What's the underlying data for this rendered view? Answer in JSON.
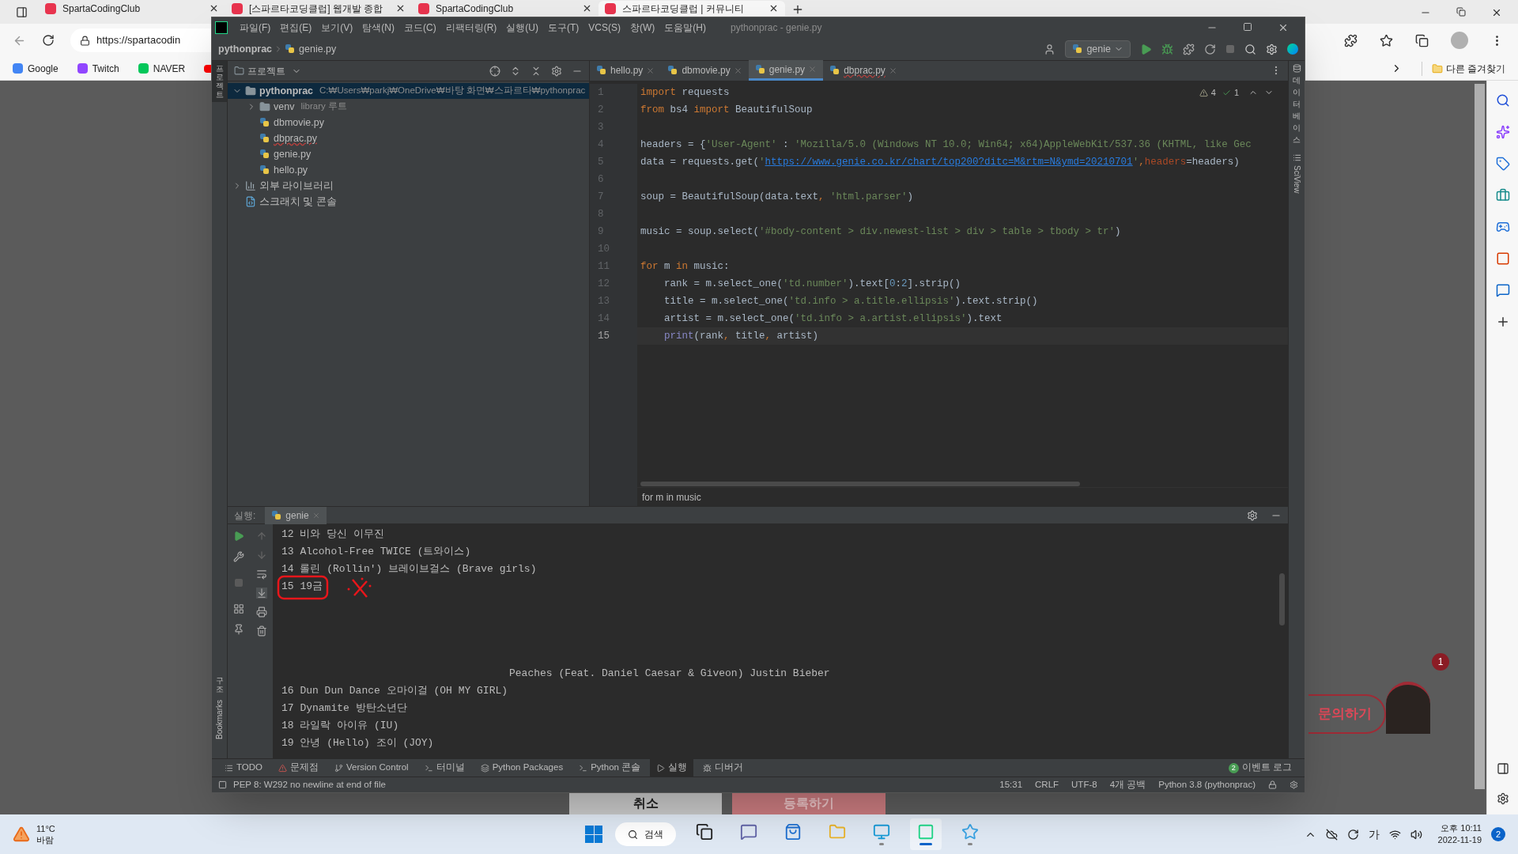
{
  "browser": {
    "tabs": [
      {
        "title": "SpartaCodingClub",
        "selected": false
      },
      {
        "title": "[스파르타코딩클럽] 웹개발 종합",
        "selected": false
      },
      {
        "title": "SpartaCodingClub",
        "selected": false
      },
      {
        "title": "스파르타코딩클럽 | 커뮤니티",
        "selected": true
      }
    ],
    "address": "https://spartacodin",
    "bookmarks": [
      {
        "label": "Google",
        "kind": "google"
      },
      {
        "label": "Twitch",
        "kind": "twitch"
      },
      {
        "label": "NAVER",
        "kind": "naver"
      }
    ],
    "other_bookmarks": "다른 즐겨찾기"
  },
  "page": {
    "cancel": "취소",
    "submit": "등록하기",
    "inquiry": "문의하기",
    "inquiry_badge": "1"
  },
  "ide": {
    "title": "pythonprac - genie.py",
    "menu": [
      "파일(F)",
      "편집(E)",
      "보기(V)",
      "탐색(N)",
      "코드(C)",
      "리팩터링(R)",
      "실행(U)",
      "도구(T)",
      "VCS(S)",
      "창(W)",
      "도움말(H)"
    ],
    "breadcrumb": [
      "pythonprac",
      "genie.py"
    ],
    "run_config": "genie",
    "left_tools_top": "프로젝트",
    "left_tools_bottom": [
      "구조",
      "Bookmarks"
    ],
    "right_tools": [
      {
        "label": "데이터베이스",
        "kind": "stack"
      },
      {
        "label": "SciView",
        "kind": "latin"
      }
    ],
    "project_panel": {
      "title": "프로젝트",
      "tree": [
        {
          "name": "pythonprac",
          "path": "C:₩Users₩parkj₩OneDrive₩바탕 화면₩스파르타₩pythonprac",
          "kind": "folder",
          "expanded": true,
          "selected": true,
          "children": [
            {
              "name": "venv",
              "path": "library 루트",
              "kind": "folder",
              "expanded": false,
              "selected": false
            },
            {
              "name": "dbmovie.py",
              "kind": "file",
              "error": false,
              "selected": false
            },
            {
              "name": "dbprac.py",
              "kind": "file",
              "error": true,
              "selected": false
            },
            {
              "name": "genie.py",
              "kind": "file",
              "error": false,
              "selected": false
            },
            {
              "name": "hello.py",
              "kind": "file",
              "error": false,
              "selected": false
            }
          ]
        },
        {
          "name": "외부 라이브러리",
          "kind": "library",
          "expanded": false,
          "selected": false
        },
        {
          "name": "스크래치 및 콘솔",
          "kind": "scratch",
          "selected": false
        }
      ]
    },
    "editor_tabs": [
      {
        "label": "hello.py",
        "selected": false,
        "error": false
      },
      {
        "label": "dbmovie.py",
        "selected": false,
        "error": false
      },
      {
        "label": "genie.py",
        "selected": true,
        "error": false
      },
      {
        "label": "dbprac.py",
        "selected": false,
        "error": true
      }
    ],
    "inspections": {
      "warnings": "4",
      "ok": "1"
    },
    "code": [
      {
        "n": "1",
        "current": false,
        "tokens": [
          {
            "kind": "kw",
            "text": "import"
          },
          {
            "kind": "p",
            "text": " requests"
          }
        ]
      },
      {
        "n": "2",
        "current": false,
        "tokens": [
          {
            "kind": "kw",
            "text": "from"
          },
          {
            "kind": "p",
            "text": " bs4 "
          },
          {
            "kind": "kw",
            "text": "import"
          },
          {
            "kind": "p",
            "text": " BeautifulSoup"
          }
        ]
      },
      {
        "n": "3",
        "current": false
      },
      {
        "n": "4",
        "current": false,
        "tokens": [
          {
            "kind": "p",
            "text": "headers = {"
          },
          {
            "kind": "str",
            "text": "'User-Agent'"
          },
          {
            "kind": "p",
            "text": " : "
          },
          {
            "kind": "str",
            "text": "'Mozilla/5.0 (Windows NT 10.0; Win64; x64)AppleWebKit/537.36 (KHTML, like Gec"
          }
        ]
      },
      {
        "n": "5",
        "current": false,
        "tokens": [
          {
            "kind": "p",
            "text": "data = requests.get("
          },
          {
            "kind": "str",
            "text": "'"
          },
          {
            "kind": "url",
            "text": "https://www.genie.co.kr/chart/top200?ditc=M&rtm=N&ymd=20210701"
          },
          {
            "kind": "str",
            "text": "'"
          },
          {
            "kind": "kw",
            "text": ","
          },
          {
            "kind": "param",
            "text": "headers"
          },
          {
            "kind": "p",
            "text": "=headers)"
          }
        ]
      },
      {
        "n": "6",
        "current": false
      },
      {
        "n": "7",
        "current": false,
        "tokens": [
          {
            "kind": "p",
            "text": "soup = BeautifulSoup(data.text"
          },
          {
            "kind": "kw",
            "text": ", "
          },
          {
            "kind": "str",
            "text": "'html.parser'"
          },
          {
            "kind": "p",
            "text": ")"
          }
        ]
      },
      {
        "n": "8",
        "current": false
      },
      {
        "n": "9",
        "current": false,
        "tokens": [
          {
            "kind": "p",
            "text": "music = soup.select("
          },
          {
            "kind": "str",
            "text": "'#body-content > div.newest-list > div > table > tbody > tr'"
          },
          {
            "kind": "p",
            "text": ")"
          }
        ]
      },
      {
        "n": "10",
        "current": false
      },
      {
        "n": "11",
        "current": false,
        "tokens": [
          {
            "kind": "kw",
            "text": "for"
          },
          {
            "kind": "p",
            "text": " m "
          },
          {
            "kind": "kw",
            "text": "in"
          },
          {
            "kind": "p",
            "text": " music:"
          }
        ]
      },
      {
        "n": "12",
        "current": false,
        "tokens": [
          {
            "kind": "p",
            "text": "    rank = m.select_one("
          },
          {
            "kind": "str",
            "text": "'td.number'"
          },
          {
            "kind": "p",
            "text": ").text["
          },
          {
            "kind": "num",
            "text": "0"
          },
          {
            "kind": "p",
            "text": ":"
          },
          {
            "kind": "num",
            "text": "2"
          },
          {
            "kind": "p",
            "text": "].strip()"
          }
        ]
      },
      {
        "n": "13",
        "current": false,
        "tokens": [
          {
            "kind": "p",
            "text": "    title = m.select_one("
          },
          {
            "kind": "str",
            "text": "'td.info > a.title.ellipsis'"
          },
          {
            "kind": "p",
            "text": ").text.strip()"
          }
        ]
      },
      {
        "n": "14",
        "current": false,
        "tokens": [
          {
            "kind": "p",
            "text": "    artist = m.select_one("
          },
          {
            "kind": "str",
            "text": "'td.info > a.artist.ellipsis'"
          },
          {
            "kind": "p",
            "text": ").text"
          }
        ]
      },
      {
        "n": "15",
        "current": true,
        "tokens": [
          {
            "kind": "fn",
            "text": "    print"
          },
          {
            "kind": "p",
            "text": "(rank"
          },
          {
            "kind": "kw",
            "text": ", "
          },
          {
            "kind": "p",
            "text": "title"
          },
          {
            "kind": "kw",
            "text": ", "
          },
          {
            "kind": "p",
            "text": "artist)"
          }
        ]
      }
    ],
    "editor_breadcrumb": "for m in music",
    "run": {
      "label": "실행:",
      "tab": "genie",
      "output": [
        {
          "text": "12 비와 당신 이무진",
          "kind": "line"
        },
        {
          "text": "13 Alcohol-Free TWICE (트와이스)",
          "kind": "line"
        },
        {
          "text": "14 롤린 (Rollin') 브레이브걸스 (Brave girls)",
          "kind": "line"
        },
        {
          "text": "15 19금",
          "kind": "line"
        },
        {
          "kind": "blank"
        },
        {
          "kind": "blank"
        },
        {
          "kind": "blank"
        },
        {
          "kind": "blank"
        },
        {
          "text": "Peaches (Feat. Daniel Caesar & Giveon) Justin Bieber",
          "kind": "indented"
        },
        {
          "text": "16 Dun Dun Dance 오마이걸 (OH MY GIRL)",
          "kind": "line"
        },
        {
          "text": "17 Dynamite 방탄소년단",
          "kind": "line"
        },
        {
          "text": "18 라일락 아이유 (IU)",
          "kind": "line"
        },
        {
          "text": "19 안녕 (Hello) 조이 (JOY)",
          "kind": "line"
        }
      ]
    },
    "tool_tabs": [
      {
        "label": "TODO",
        "kind": "todo",
        "selected": false
      },
      {
        "label": "문제점",
        "kind": "problems",
        "selected": false
      },
      {
        "label": "Version Control",
        "kind": "vcs",
        "selected": false
      },
      {
        "label": "터미널",
        "kind": "terminal",
        "selected": false
      },
      {
        "label": "Python Packages",
        "kind": "packages",
        "selected": false
      },
      {
        "label": "Python 콘솔",
        "kind": "console",
        "selected": false
      },
      {
        "label": "실행",
        "kind": "run",
        "selected": true
      },
      {
        "label": "디버거",
        "kind": "debug",
        "selected": false
      }
    ],
    "event_log": {
      "count": "2",
      "label": "이벤트 로그"
    },
    "status": {
      "message": "PEP 8: W292 no newline at end of file",
      "items": [
        "15:31",
        "CRLF",
        "UTF-8",
        "4개 공백",
        "Python 3.8 (pythonprac)"
      ]
    }
  },
  "taskbar": {
    "weather": {
      "temp": "11°C",
      "desc": "바람"
    },
    "search": "검색",
    "apps": [
      {
        "kind": "taskview",
        "running": false,
        "selected": false
      },
      {
        "kind": "chat",
        "running": false,
        "selected": false
      },
      {
        "kind": "store",
        "running": false,
        "selected": false
      },
      {
        "kind": "explorer",
        "running": false,
        "selected": false
      },
      {
        "kind": "edge",
        "running": true,
        "selected": false
      },
      {
        "kind": "pycharm",
        "running": true,
        "selected": true
      },
      {
        "kind": "paint",
        "running": true,
        "selected": false
      }
    ],
    "ime": "가",
    "time": "오후 10:11",
    "date": "2022-11-19",
    "notifications": "2"
  }
}
